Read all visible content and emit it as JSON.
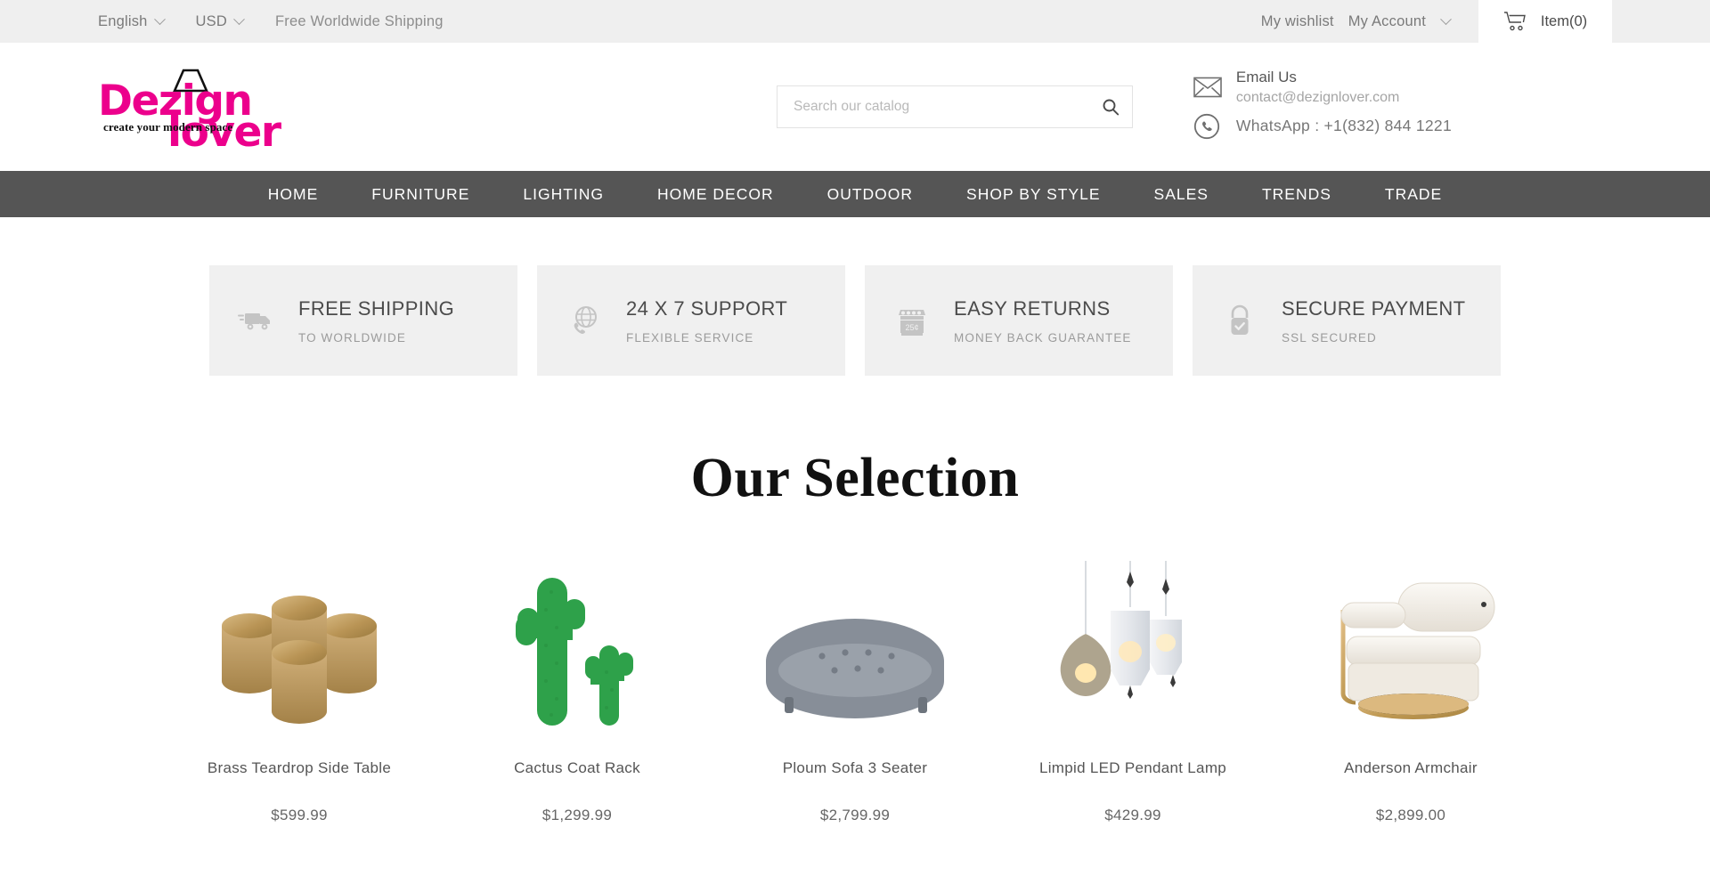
{
  "topbar": {
    "language": "English",
    "currency": "USD",
    "shipping_note": "Free Worldwide Shipping",
    "wishlist": "My wishlist",
    "account": "My Account",
    "cart_label": "Item(0)",
    "cart_icon": "shopping-cart-icon",
    "chevron_icon": "chevron-down-icon"
  },
  "header": {
    "logo": {
      "part1": "Dezign",
      "part2": "lover",
      "tagline": "create your modern space",
      "color": "#ec008c"
    },
    "search": {
      "placeholder": "Search our catalog",
      "value": "",
      "icon": "search-icon"
    },
    "contact": {
      "email_title": "Email Us",
      "email_address": "contact@dezignlover.com",
      "whatsapp": "WhatsApp : +1(832) 844 1221",
      "email_icon": "envelope-icon",
      "whatsapp_icon": "whatsapp-phone-icon"
    }
  },
  "nav": {
    "background": "#555555",
    "items": [
      {
        "label": "HOME"
      },
      {
        "label": "FURNITURE"
      },
      {
        "label": "LIGHTING"
      },
      {
        "label": "HOME DECOR"
      },
      {
        "label": "OUTDOOR"
      },
      {
        "label": "SHOP BY STYLE"
      },
      {
        "label": "SALES"
      },
      {
        "label": "TRENDS"
      },
      {
        "label": "TRADE"
      }
    ]
  },
  "features": [
    {
      "title": "FREE SHIPPING",
      "subtitle": "TO WORLDWIDE",
      "icon": "delivery-truck-icon"
    },
    {
      "title": "24 X 7 SUPPORT",
      "subtitle": "FLEXIBLE SERVICE",
      "icon": "globe-phone-icon"
    },
    {
      "title": "EASY RETURNS",
      "subtitle": "MONEY BACK GUARANTEE",
      "icon": "return-shop-icon"
    },
    {
      "title": "SECURE PAYMENT",
      "subtitle": "SSL SECURED",
      "icon": "lock-check-icon"
    }
  ],
  "selection": {
    "title": "Our Selection",
    "products": [
      {
        "name": "Brass Teardrop Side Table",
        "price": "$599.99",
        "image": "brass-clover-table"
      },
      {
        "name": "Cactus Coat Rack",
        "price": "$1,299.99",
        "image": "green-cactus-pair"
      },
      {
        "name": "Ploum Sofa 3 Seater",
        "price": "$2,799.99",
        "image": "grey-tufted-sofa"
      },
      {
        "name": "Limpid LED Pendant Lamp",
        "price": "$429.99",
        "image": "glass-pendant-cluster"
      },
      {
        "name": "Anderson Armchair",
        "price": "$2,899.00",
        "image": "cream-brass-armchair"
      }
    ]
  }
}
